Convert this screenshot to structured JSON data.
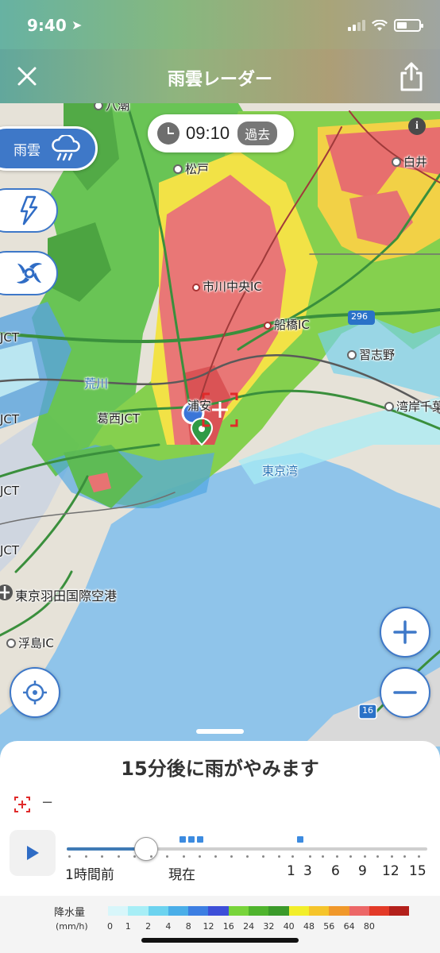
{
  "status_bar": {
    "time": "9:40",
    "location_icon": "location-arrow-icon",
    "signal_icon": "cellular-signal-icon",
    "wifi_icon": "wifi-icon",
    "battery_icon": "battery-icon"
  },
  "header": {
    "title": "雨雲レーダー",
    "close_icon": "close-icon",
    "share_icon": "share-icon"
  },
  "time_display": {
    "time": "09:10",
    "badge": "過去",
    "icon": "clock-icon"
  },
  "info_button": {
    "label": "i"
  },
  "layers": [
    {
      "label": "雨雲",
      "icon": "rain-cloud-icon",
      "selected": true
    },
    {
      "label": "",
      "icon": "lightning-icon",
      "selected": false
    },
    {
      "label": "",
      "icon": "typhoon-icon",
      "selected": false
    }
  ],
  "map_labels": {
    "yashio": "八潮",
    "matsudo": "松戸",
    "shiroi": "白井",
    "ichikawa_chuo_ic": "市川中央IC",
    "funabashi_ic": "船橋IC",
    "route_296": "296",
    "narashino": "習志野",
    "arakawa": "荒川",
    "kasai_jct": "葛西JCT",
    "urayasu": "浦安",
    "wangan_chiba": "湾岸千葉",
    "tokyo_bay": "東京湾",
    "jct_1": "JCT",
    "jct_2": "JCT",
    "jct_3": "JCT",
    "jct_4": "JCT",
    "haneda": "東京羽田国際空港",
    "ukishima_ic": "浮島IC",
    "route_16": "16"
  },
  "controls": {
    "zoom_in": "+",
    "zoom_out": "−",
    "locate_icon": "crosshair-icon"
  },
  "forecast": {
    "message": "15分後に雨がやみます",
    "target_icon": "target-marker-icon",
    "target_value": "−"
  },
  "timeline": {
    "play_icon": "play-icon",
    "progress": 0.22,
    "labels": [
      "1時間前",
      "現在",
      "1",
      "3",
      "6",
      "9",
      "12",
      "15"
    ]
  },
  "legend": {
    "title": "降水量",
    "unit": "(mm/h)",
    "values": [
      "0",
      "1",
      "2",
      "4",
      "8",
      "12",
      "16",
      "24",
      "32",
      "40",
      "48",
      "56",
      "64",
      "80"
    ],
    "colors": [
      "#d8f6fa",
      "#a7eef6",
      "#6cd3ef",
      "#4aaee8",
      "#3c7ee2",
      "#3d4fd8",
      "#77d43a",
      "#4fb42d",
      "#3b9a2a",
      "#f2ee2a",
      "#f5c42a",
      "#f0982a",
      "#ec6767",
      "#e33a28",
      "#b3201b"
    ]
  }
}
